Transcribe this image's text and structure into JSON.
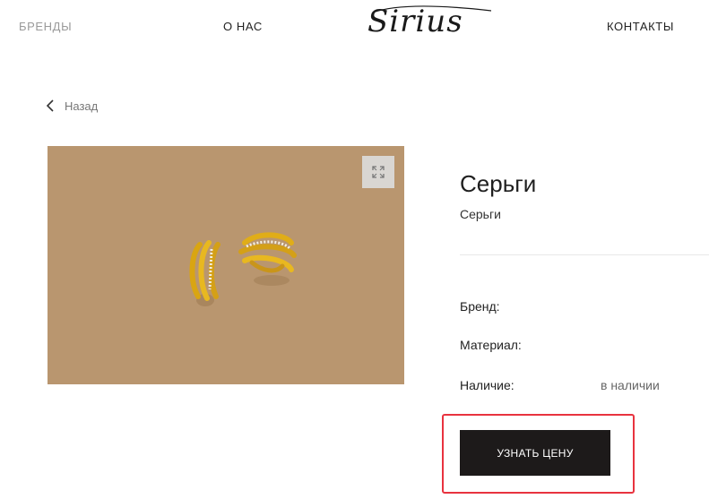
{
  "header": {
    "nav_brands": "БРЕНДЫ",
    "nav_about": "О НАС",
    "logo_text": "Sirius",
    "nav_contacts": "КОНТАКТЫ"
  },
  "back": {
    "label": "Назад",
    "icon": "chevron-left-icon"
  },
  "gallery": {
    "expand_icon": "expand-icon",
    "background_color": "#b9966f"
  },
  "product": {
    "title": "Серьги",
    "subtitle": "Серьги",
    "specs": [
      {
        "label": "Бренд:",
        "value": ""
      },
      {
        "label": "Материал:",
        "value": ""
      },
      {
        "label": "Наличие:",
        "value": "в наличии"
      }
    ]
  },
  "cta": {
    "label": "УЗНАТЬ ЦЕНУ",
    "button_color": "#1d1a1a",
    "highlight_color": "#e8333f"
  }
}
